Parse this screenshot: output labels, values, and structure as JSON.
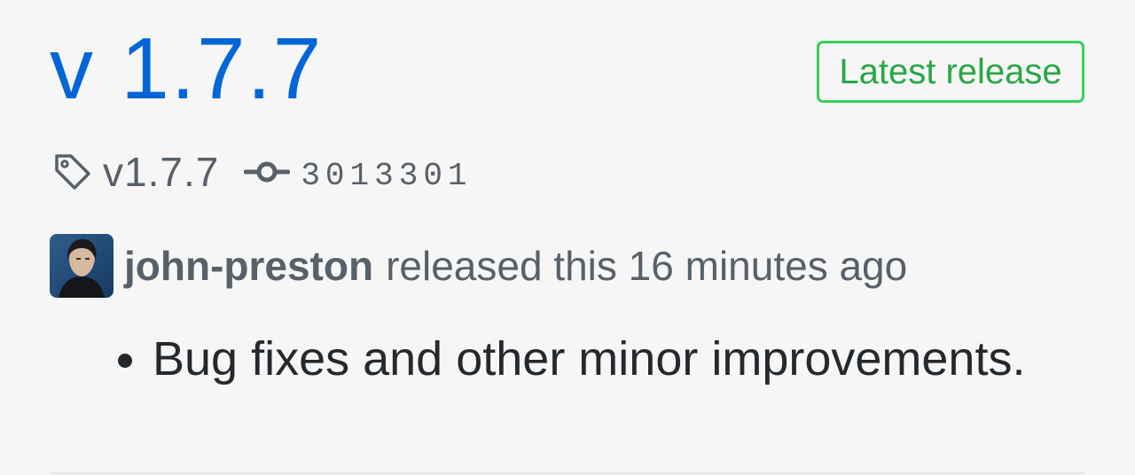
{
  "release": {
    "title": "v 1.7.7",
    "badge": "Latest release",
    "tag": "v1.7.7",
    "commit": "3013301",
    "author": "john-preston",
    "released_text": "released this 16 minutes ago",
    "notes": [
      "Bug fixes and other minor improvements."
    ]
  },
  "icons": {
    "tag": "tag-icon",
    "commit": "git-commit-icon",
    "avatar": "author-avatar"
  },
  "colors": {
    "link": "#0366d6",
    "badge_border": "#34d058",
    "badge_text": "#28a745",
    "muted": "#586069",
    "body_text": "#24292e",
    "background": "#f6f6f6"
  }
}
